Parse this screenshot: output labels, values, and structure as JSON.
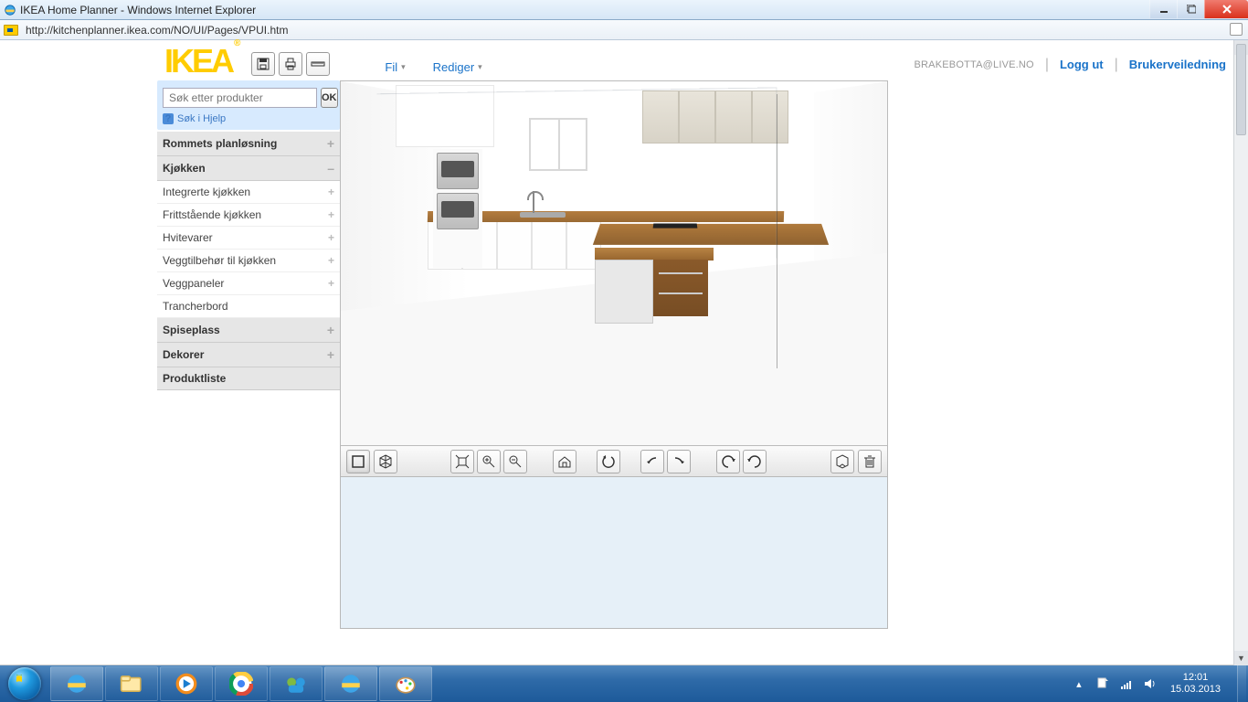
{
  "window": {
    "title": "IKEA Home Planner - Windows Internet Explorer",
    "url": "http://kitchenplanner.ikea.com/NO/UI/Pages/VPUI.htm"
  },
  "logo": "IKEA",
  "menu": {
    "file": "Fil",
    "edit": "Rediger"
  },
  "header": {
    "email": "BRAKEBOTTA@LIVE.NO",
    "logout": "Logg ut",
    "guide": "Brukerveiledning"
  },
  "search": {
    "placeholder": "Søk etter produkter",
    "ok": "OK",
    "help": "Søk i Hjelp"
  },
  "sidebar": {
    "room": "Rommets planløsning",
    "kitchen": "Kjøkken",
    "sub": {
      "integrated": "Integrerte kjøkken",
      "freestanding": "Frittstående kjøkken",
      "appliances": "Hvitevarer",
      "wallacc": "Veggtilbehør til kjøkken",
      "wallpanels": "Veggpaneler",
      "cutting": "Trancherbord"
    },
    "dining": "Spiseplass",
    "decorate": "Dekorer",
    "prodlist": "Produktliste"
  },
  "taskbar": {
    "time": "12:01",
    "date": "15.03.2013"
  }
}
